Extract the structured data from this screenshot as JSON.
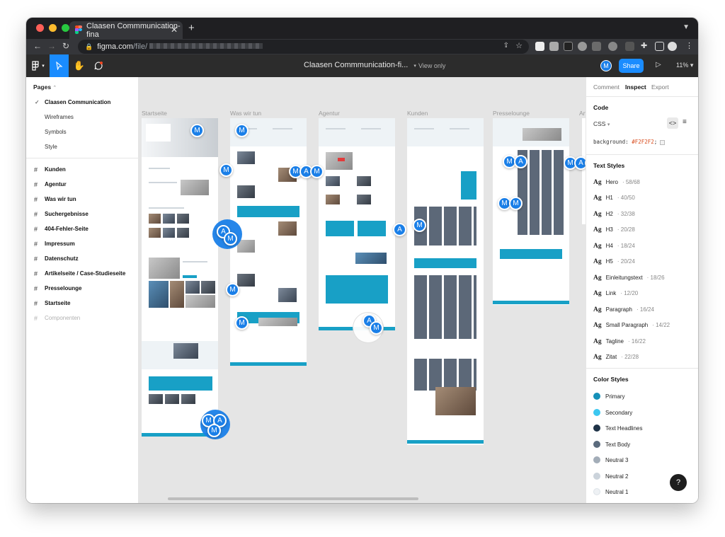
{
  "browser": {
    "tab_title": "Claasen Commmunication-fina",
    "tab_close": "✕",
    "new_tab": "+",
    "url_host": "figma.com",
    "url_path": "/file/"
  },
  "toolbar": {
    "doc_title": "Claasen Commmunication-fi...",
    "view_only": "View only",
    "avatar": "M",
    "share_label": "Share",
    "zoom": "11%"
  },
  "pages": {
    "header": "Pages",
    "items": [
      {
        "label": "Claasen Communication",
        "selected": true,
        "kind": "check"
      },
      {
        "label": "Wireframes",
        "kind": "plain"
      },
      {
        "label": "Symbols",
        "kind": "plain"
      },
      {
        "label": "Style",
        "kind": "plain"
      },
      {
        "label": "Kunden",
        "kind": "hash"
      },
      {
        "label": "Agentur",
        "kind": "hash"
      },
      {
        "label": "Was wir tun",
        "kind": "hash"
      },
      {
        "label": "Suchergebnisse",
        "kind": "hash"
      },
      {
        "label": "404-Fehler-Seite",
        "kind": "hash"
      },
      {
        "label": "Impressum",
        "kind": "hash"
      },
      {
        "label": "Datenschutz",
        "kind": "hash"
      },
      {
        "label": "Artikelseite / Case-Studieseite",
        "kind": "hash"
      },
      {
        "label": "Presselounge",
        "kind": "hash"
      },
      {
        "label": "Startseite",
        "kind": "hash"
      },
      {
        "label": "Componenten",
        "kind": "hash",
        "muted": true
      }
    ]
  },
  "canvas": {
    "frames": [
      "Startseite",
      "Was wir tun",
      "Agentur",
      "Kunden",
      "Presselounge",
      "Art"
    ],
    "cursor_letters": [
      "M",
      "A"
    ]
  },
  "inspect": {
    "tabs": [
      "Comment",
      "Inspect",
      "Export"
    ],
    "active_tab": "Inspect",
    "code_header": "Code",
    "code_language": "CSS",
    "code_property": "background:",
    "code_value": "#F2F2F2",
    "code_end": ";",
    "text_styles_header": "Text Styles",
    "text_styles": [
      {
        "name": "Hero",
        "size": "58/68"
      },
      {
        "name": "H1",
        "size": "40/50"
      },
      {
        "name": "H2",
        "size": "32/38"
      },
      {
        "name": "H3",
        "size": "20/28"
      },
      {
        "name": "H4",
        "size": "18/24"
      },
      {
        "name": "H5",
        "size": "20/24"
      },
      {
        "name": "Einleitungstext",
        "size": "18/26"
      },
      {
        "name": "Link",
        "size": "12/20"
      },
      {
        "name": "Paragraph",
        "size": "16/24"
      },
      {
        "name": "Small Paragraph",
        "size": "14/22"
      },
      {
        "name": "Tagline",
        "size": "16/22"
      },
      {
        "name": "Zitat",
        "size": "22/28"
      }
    ],
    "ag": "Ag",
    "color_styles_header": "Color Styles",
    "color_styles": [
      {
        "name": "Primary",
        "color": "#1590b8"
      },
      {
        "name": "Secondary",
        "color": "#3cc7f0"
      },
      {
        "name": "Text Headlines",
        "color": "#1e3347"
      },
      {
        "name": "Text Body",
        "color": "#5b6b7d"
      },
      {
        "name": "Neutral 3",
        "color": "#a3adb8"
      },
      {
        "name": "Neutral 2",
        "color": "#cbd3db"
      },
      {
        "name": "Neutral 1",
        "color": "#eef1f4"
      }
    ]
  },
  "help": "?"
}
